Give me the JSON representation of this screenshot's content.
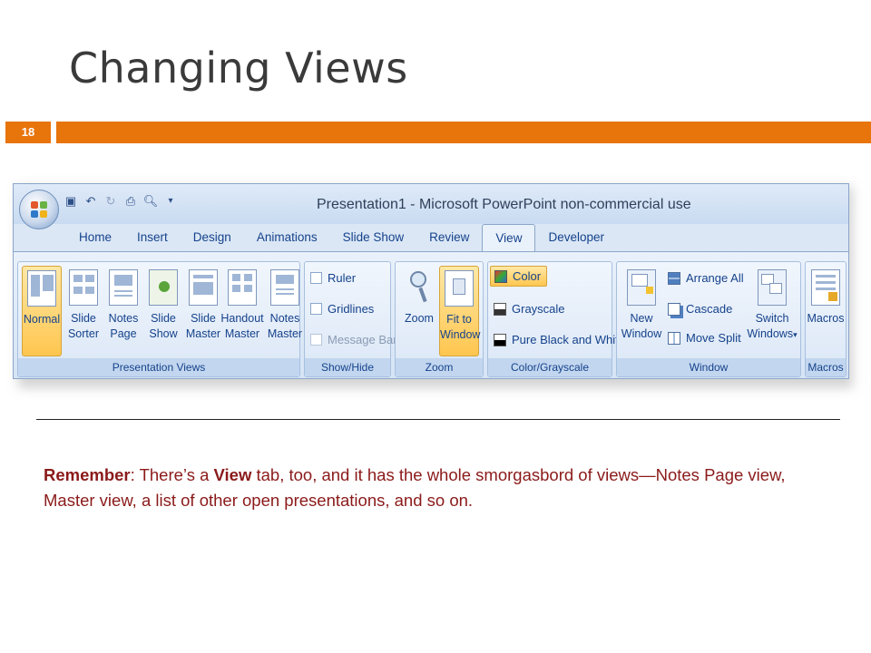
{
  "slide": {
    "title": "Changing Views",
    "number": "18",
    "accent_color": "#e8740c"
  },
  "window": {
    "title": "Presentation1 - Microsoft PowerPoint non-commercial use",
    "qat_icons": [
      "save-icon",
      "undo-icon",
      "redo-icon",
      "print-icon",
      "print-preview-icon",
      "customize-icon"
    ]
  },
  "tabs": [
    {
      "label": "Home"
    },
    {
      "label": "Insert"
    },
    {
      "label": "Design"
    },
    {
      "label": "Animations"
    },
    {
      "label": "Slide Show"
    },
    {
      "label": "Review"
    },
    {
      "label": "View",
      "active": true
    },
    {
      "label": "Developer"
    }
  ],
  "groups": {
    "presentation_views": {
      "label": "Presentation Views",
      "buttons": [
        "Normal",
        "Slide\nSorter",
        "Notes\nPage",
        "Slide\nShow",
        "Slide\nMaster",
        "Handout\nMaster",
        "Notes\nMaster"
      ]
    },
    "show_hide": {
      "label": "Show/Hide",
      "items": [
        "Ruler",
        "Gridlines",
        "Message Bar"
      ]
    },
    "zoom": {
      "label": "Zoom",
      "buttons": [
        "Zoom",
        "Fit to\nWindow"
      ]
    },
    "color_grayscale": {
      "label": "Color/Grayscale",
      "items": [
        "Color",
        "Grayscale",
        "Pure Black and White"
      ]
    },
    "window": {
      "label": "Window",
      "buttons": [
        "New\nWindow",
        "Switch\nWindows"
      ],
      "items": [
        "Arrange All",
        "Cascade",
        "Move Split"
      ],
      "dropdown_glyph": "▾"
    },
    "macros": {
      "label": "Macros",
      "buttons": [
        "Macros"
      ]
    }
  },
  "note": {
    "lead": "Remember",
    "part1": ": There’s a ",
    "emph": "View",
    "part2": " tab, too, and it has the whole smorgasbord of views—Notes Page view, Master view, a list of other open presentations, and so on."
  }
}
